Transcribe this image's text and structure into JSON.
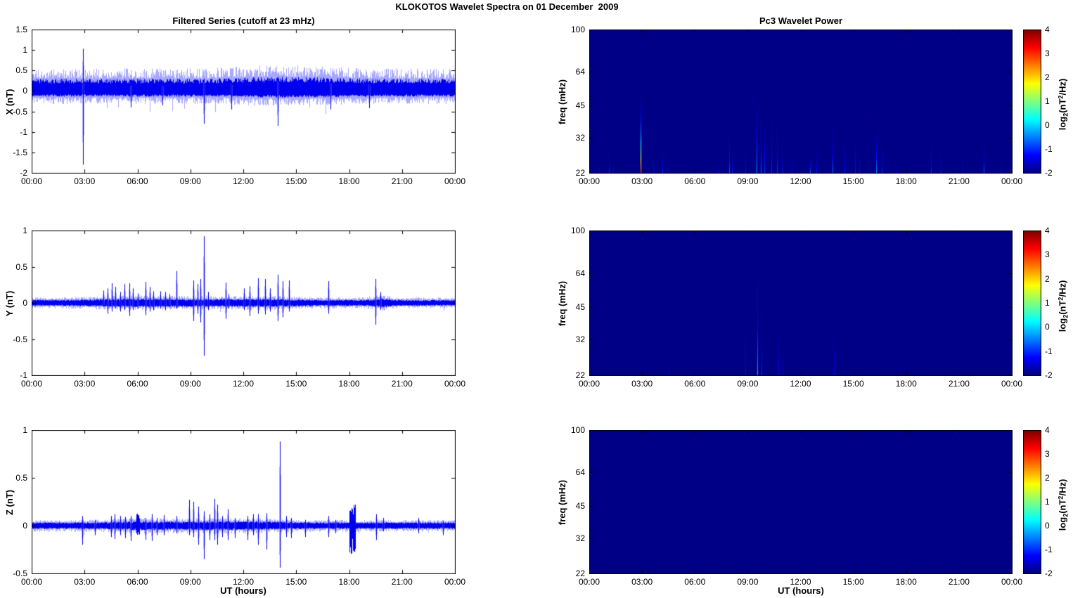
{
  "figure_title": "KLOKOTOS Wavelet Spectra on 01 December  2009",
  "xlabel": "UT (hours)",
  "time_ticks": [
    "00:00",
    "03:00",
    "06:00",
    "09:00",
    "12:00",
    "15:00",
    "18:00",
    "21:00",
    "00:00"
  ],
  "colors": {
    "series_line": "#0000ee",
    "series_envelope": "rgba(80,80,255,0.5)",
    "spectrogram_background": "#000086",
    "axis": "#000000",
    "colorbar_top": "#800000",
    "colorbar_bottom": "#000080"
  },
  "colorbar": {
    "range": [
      -2,
      4
    ],
    "ticks": [
      "4",
      "3",
      "2",
      "1",
      "0",
      "-1",
      "-2"
    ],
    "label_parts": {
      "p1": "log",
      "sub1": "2",
      "p2": "(nT",
      "sup1": "2",
      "p3": "/Hz)"
    }
  },
  "chart_data": [
    {
      "id": "x_filtered_series",
      "type": "line",
      "title": "Filtered Series (cutoff at 23 mHz)",
      "ylabel": "X (nT)",
      "ylim": [
        -2,
        1.5
      ],
      "yticks": [
        "1.5",
        "1",
        "0.5",
        "0",
        "-0.5",
        "-1",
        "-1.5",
        "-2"
      ],
      "x_hours": [
        0,
        24
      ],
      "noise": {
        "env_pos": 0.55,
        "env_neg": 0.32,
        "core_pos": 0.3,
        "core_neg": 0.14,
        "regions": [
          {
            "c": 13.5,
            "s": 1.5,
            "f": 1.15
          },
          {
            "c": 16.5,
            "s": 1.2,
            "f": 1.1
          }
        ]
      },
      "spikes": [
        [
          2.92,
          1.03,
          -1.8
        ],
        [
          5.6,
          0.2,
          -0.4
        ],
        [
          7.4,
          0.2,
          -0.35
        ],
        [
          9.75,
          0.3,
          -0.8
        ],
        [
          11.3,
          0.25,
          -0.45
        ],
        [
          13.95,
          0.35,
          -0.85
        ],
        [
          16.9,
          0.3,
          -0.45
        ],
        [
          19.1,
          0.25,
          -0.42
        ]
      ],
      "bursts": []
    },
    {
      "id": "x_wavelet_power",
      "type": "heatmap",
      "title": "Pc3 Wavelet Power",
      "ylabel": "freq (mHz)",
      "yticks": [
        "100",
        "64",
        "45",
        "32",
        "22"
      ],
      "freq_range": [
        22,
        100
      ],
      "log_scale": true,
      "value_range": [
        -2,
        4
      ],
      "background_value": -2,
      "streaks": [
        [
          0.55,
          25,
          -1.1
        ],
        [
          1.1,
          30,
          -0.85
        ],
        [
          1.35,
          26,
          -1.2
        ],
        [
          2.9,
          60,
          3.2
        ],
        [
          2.95,
          72,
          -1.0
        ],
        [
          3.65,
          28,
          -1.1
        ],
        [
          4.15,
          32,
          -0.9
        ],
        [
          4.45,
          26,
          -1.2
        ],
        [
          7.3,
          26,
          -1.3
        ],
        [
          7.95,
          40,
          -0.6
        ],
        [
          8.1,
          30,
          -1.0
        ],
        [
          8.85,
          32,
          -1.0
        ],
        [
          9.5,
          78,
          -0.25
        ],
        [
          9.75,
          50,
          -0.6
        ],
        [
          9.95,
          46,
          -0.8
        ],
        [
          10.35,
          52,
          -0.9
        ],
        [
          10.65,
          46,
          -0.8
        ],
        [
          11.0,
          36,
          -0.9
        ],
        [
          11.5,
          30,
          -1.2
        ],
        [
          12.55,
          28,
          -0.4
        ],
        [
          12.9,
          32,
          -1.0
        ],
        [
          13.8,
          44,
          -0.5
        ],
        [
          14.5,
          36,
          -1.0
        ],
        [
          15.1,
          38,
          -1.0
        ],
        [
          15.35,
          30,
          -1.1
        ],
        [
          16.3,
          41,
          -0.3
        ],
        [
          16.6,
          36,
          -0.9
        ],
        [
          17.4,
          26,
          -1.3
        ],
        [
          19.4,
          36,
          -0.9
        ],
        [
          19.95,
          31,
          -1.0
        ],
        [
          21.2,
          28,
          -1.2
        ],
        [
          22.4,
          36,
          -0.6
        ],
        [
          23.4,
          27,
          -1.2
        ]
      ]
    },
    {
      "id": "y_filtered_series",
      "type": "line",
      "title": "",
      "ylabel": "Y (nT)",
      "ylim": [
        -1,
        1
      ],
      "yticks": [
        "1",
        "0.5",
        "0",
        "-0.5",
        "-1"
      ],
      "x_hours": [
        0,
        24
      ],
      "noise": {
        "env_pos": 0.075,
        "env_neg": 0.075,
        "core_pos": 0.042,
        "core_neg": 0.042,
        "regions": [
          {
            "c": 6.5,
            "s": 2.5,
            "f": 1.4
          },
          {
            "c": 13,
            "s": 2,
            "f": 1.3
          },
          {
            "c": 19.8,
            "s": 0.4,
            "f": 1.5
          }
        ]
      },
      "spikes": [
        [
          4.05,
          0.17,
          -0.05
        ],
        [
          4.3,
          0.2,
          -0.15
        ],
        [
          4.55,
          0.27,
          -0.12
        ],
        [
          4.75,
          0.22,
          -0.08
        ],
        [
          5.0,
          0.15,
          -0.12
        ],
        [
          5.25,
          0.26,
          -0.1
        ],
        [
          5.55,
          0.27,
          -0.18
        ],
        [
          5.75,
          0.2,
          -0.1
        ],
        [
          6.0,
          0.13,
          -0.08
        ],
        [
          6.45,
          0.29,
          -0.17
        ],
        [
          6.7,
          0.22,
          -0.12
        ],
        [
          6.9,
          0.16,
          -0.1
        ],
        [
          7.3,
          0.16,
          -0.08
        ],
        [
          7.55,
          0.15,
          -0.1
        ],
        [
          7.8,
          0.12,
          -0.06
        ],
        [
          8.2,
          0.44,
          -0.08
        ],
        [
          9.15,
          0.31,
          -0.25
        ],
        [
          9.4,
          0.26,
          -0.15
        ],
        [
          9.55,
          0.33,
          -0.27
        ],
        [
          9.75,
          0.92,
          -0.73
        ],
        [
          10.0,
          0.15,
          -0.1
        ],
        [
          11.0,
          0.28,
          -0.22
        ],
        [
          11.15,
          0.12,
          -0.08
        ],
        [
          12.0,
          0.2,
          -0.1
        ],
        [
          12.35,
          0.23,
          -0.18
        ],
        [
          12.8,
          0.34,
          -0.15
        ],
        [
          13.2,
          0.33,
          -0.16
        ],
        [
          13.5,
          0.2,
          -0.12
        ],
        [
          13.95,
          0.39,
          -0.25
        ],
        [
          14.2,
          0.3,
          -0.2
        ],
        [
          14.55,
          0.31,
          -0.12
        ],
        [
          16.8,
          0.3,
          -0.15
        ],
        [
          19.45,
          0.33,
          -0.3
        ],
        [
          19.75,
          0.15,
          -0.1
        ]
      ],
      "bursts": []
    },
    {
      "id": "y_wavelet_power",
      "type": "heatmap",
      "title": "",
      "ylabel": "freq (mHz)",
      "yticks": [
        "100",
        "64",
        "45",
        "32",
        "22"
      ],
      "freq_range": [
        22,
        100
      ],
      "log_scale": true,
      "value_range": [
        -2,
        4
      ],
      "background_value": -2,
      "streaks": [
        [
          4.5,
          26,
          -1.3
        ],
        [
          8.85,
          45,
          -1.1
        ],
        [
          9.55,
          92,
          -0.1
        ],
        [
          9.8,
          40,
          -0.8
        ],
        [
          10.75,
          48,
          -1.2
        ],
        [
          11.0,
          34,
          -1.3
        ],
        [
          13.9,
          45,
          -1.1
        ]
      ]
    },
    {
      "id": "z_filtered_series",
      "type": "line",
      "title": "",
      "ylabel": "Z (nT)",
      "ylim": [
        -0.5,
        1
      ],
      "yticks": [
        "1",
        "0.5",
        "0",
        "-0.5"
      ],
      "x_hours": [
        0,
        24
      ],
      "noise": {
        "env_pos": 0.06,
        "env_neg": 0.065,
        "core_pos": 0.035,
        "core_neg": 0.035,
        "regions": [
          {
            "c": 6,
            "s": 1.2,
            "f": 1.3
          },
          {
            "c": 10,
            "s": 1.8,
            "f": 1.3
          },
          {
            "c": 12.9,
            "s": 1.2,
            "f": 1.2
          }
        ]
      },
      "spikes": [
        [
          2.85,
          0.1,
          -0.2
        ],
        [
          3.6,
          0.06,
          -0.1
        ],
        [
          4.5,
          0.1,
          -0.12
        ],
        [
          4.7,
          0.12,
          -0.14
        ],
        [
          5.0,
          0.1,
          -0.1
        ],
        [
          5.3,
          0.09,
          -0.13
        ],
        [
          5.6,
          0.1,
          -0.16
        ],
        [
          6.45,
          0.08,
          -0.15
        ],
        [
          6.8,
          0.12,
          -0.16
        ],
        [
          7.1,
          0.08,
          -0.1
        ],
        [
          7.5,
          0.11,
          -0.1
        ],
        [
          8.2,
          0.1,
          -0.08
        ],
        [
          8.9,
          0.27,
          -0.1
        ],
        [
          9.15,
          0.25,
          -0.12
        ],
        [
          9.45,
          0.2,
          -0.2
        ],
        [
          9.75,
          0.15,
          -0.35
        ],
        [
          10.05,
          0.12,
          -0.15
        ],
        [
          10.35,
          0.28,
          -0.15
        ],
        [
          10.5,
          0.22,
          -0.2
        ],
        [
          10.8,
          0.1,
          -0.12
        ],
        [
          11.1,
          0.17,
          -0.15
        ],
        [
          11.5,
          0.08,
          -0.13
        ],
        [
          12.2,
          0.1,
          -0.15
        ],
        [
          12.55,
          0.12,
          -0.1
        ],
        [
          12.8,
          0.12,
          -0.2
        ],
        [
          13.3,
          0.13,
          -0.25
        ],
        [
          14.05,
          0.88,
          -0.44
        ],
        [
          14.4,
          0.1,
          -0.12
        ],
        [
          14.7,
          0.08,
          -0.13
        ],
        [
          15.5,
          0.06,
          -0.12
        ],
        [
          16.8,
          0.1,
          -0.12
        ],
        [
          17.2,
          0.06,
          -0.08
        ],
        [
          19.5,
          0.12,
          -0.15
        ],
        [
          19.9,
          0.08,
          -0.06
        ],
        [
          21.9,
          0.08,
          -0.08
        ],
        [
          23.3,
          0.05,
          -0.1
        ]
      ],
      "bursts": [
        [
          6.0,
          0.13,
          -0.1,
          0.15
        ],
        [
          18.15,
          0.22,
          -0.3,
          0.3
        ]
      ]
    },
    {
      "id": "z_wavelet_power",
      "type": "heatmap",
      "title": "",
      "ylabel": "freq (mHz)",
      "yticks": [
        "100",
        "64",
        "45",
        "32",
        "22"
      ],
      "freq_range": [
        22,
        100
      ],
      "log_scale": true,
      "value_range": [
        -2,
        4
      ],
      "background_value": -2,
      "streaks": []
    }
  ]
}
